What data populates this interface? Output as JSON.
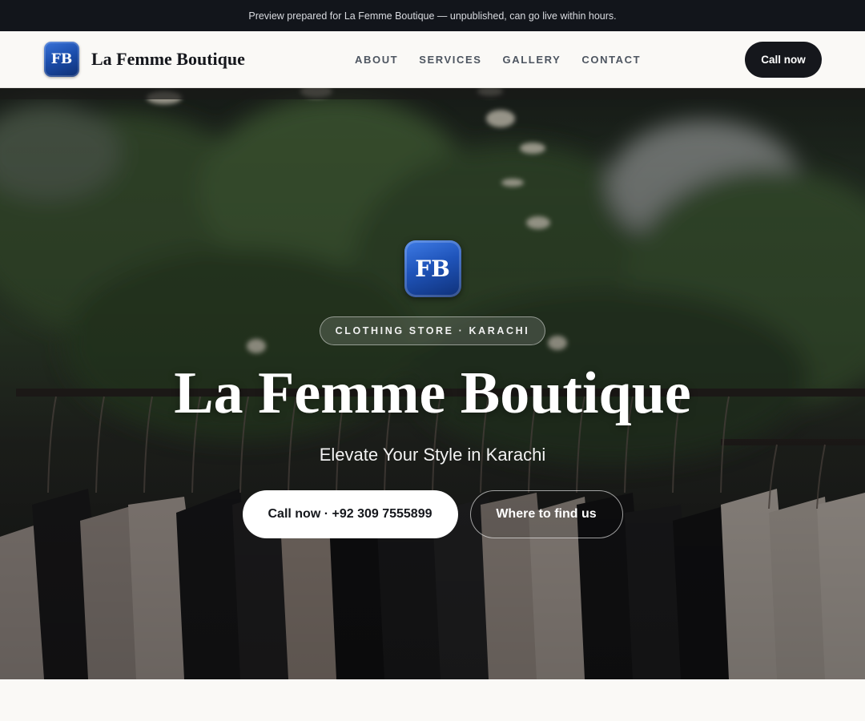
{
  "preview_banner": {
    "text": "Preview prepared for La Femme Boutique — unpublished, can go live within hours."
  },
  "header": {
    "logo_text": "FB",
    "brand_name": "La Femme Boutique",
    "nav": [
      {
        "label": "ABOUT"
      },
      {
        "label": "SERVICES"
      },
      {
        "label": "GALLERY"
      },
      {
        "label": "CONTACT"
      }
    ],
    "cta_label": "Call now"
  },
  "hero": {
    "logo_text": "FB",
    "category_pill": "CLOTHING STORE · KARACHI",
    "title": "La Femme Boutique",
    "subtitle": "Elevate Your Style in Karachi",
    "primary_button": "Call now · +92 309 7555899",
    "secondary_button": "Where to find us",
    "background_image": "clothing rack with hanging shirts in front of trees"
  },
  "colors": {
    "topbar_bg": "#12151b",
    "page_bg": "#faf9f6",
    "dark_button": "#15171c",
    "logo_blue": "#1c4fae"
  }
}
